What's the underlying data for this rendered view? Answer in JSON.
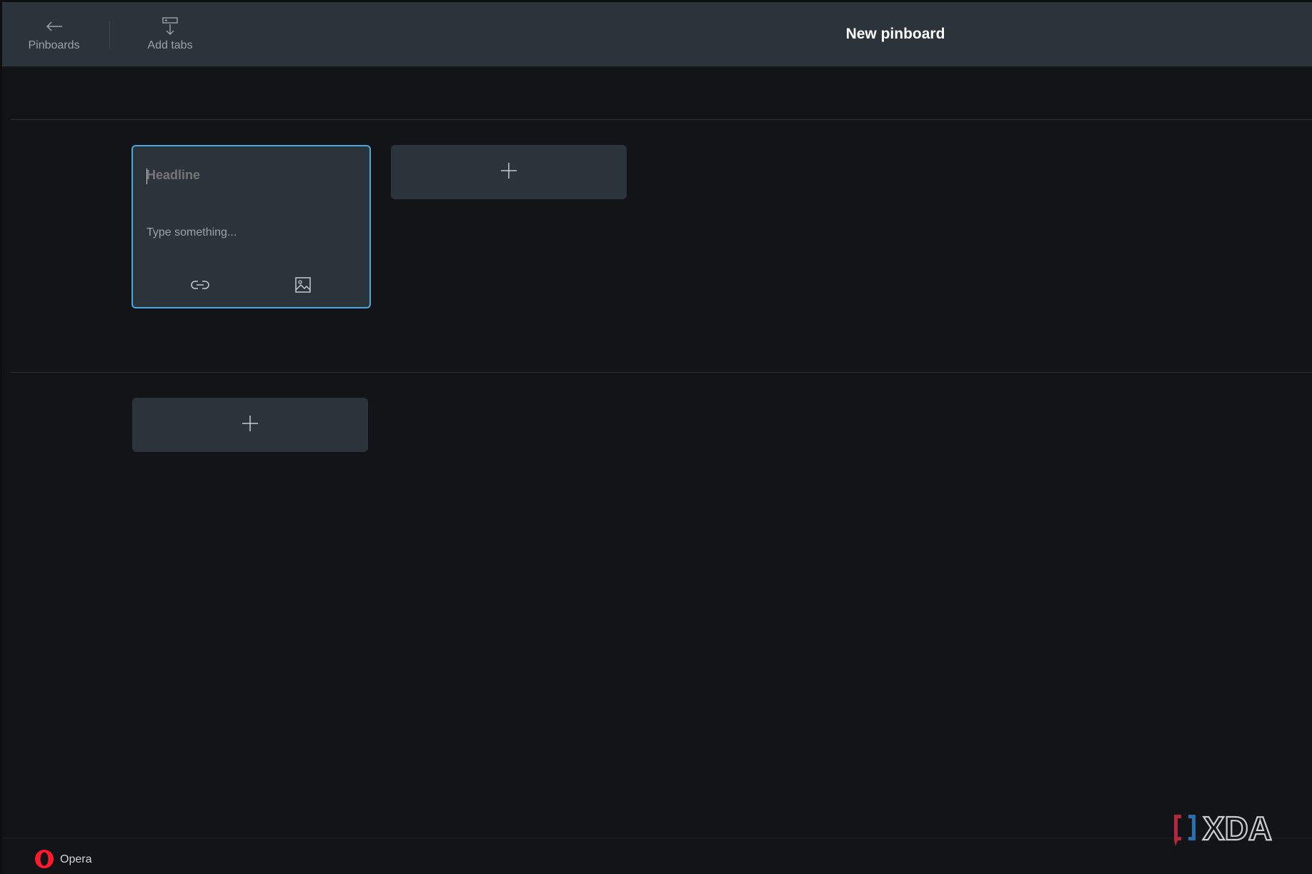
{
  "header": {
    "back_label": "Pinboards",
    "add_tabs_label": "Add tabs",
    "title": "New pinboard"
  },
  "note": {
    "headline_placeholder": "Headline",
    "body_placeholder": "Type something...",
    "tools": [
      "link-icon",
      "image-icon"
    ]
  },
  "footer": {
    "brand": "Opera"
  },
  "watermark": {
    "text": "XDA"
  },
  "colors": {
    "accent": "#4aa8e0",
    "card": "#2b333b",
    "background": "#121417",
    "opera_red": "#ff1b2d"
  }
}
